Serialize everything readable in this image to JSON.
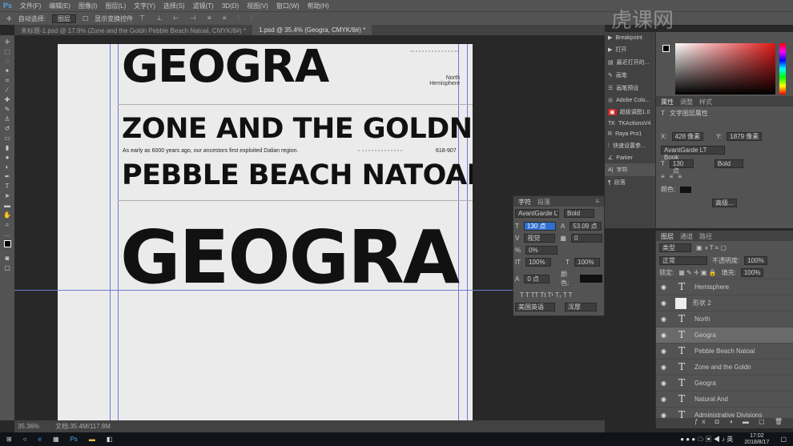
{
  "menu": {
    "items": [
      "文件(F)",
      "编辑(E)",
      "图像(I)",
      "图层(L)",
      "文字(Y)",
      "选择(S)",
      "滤镜(T)",
      "3D(D)",
      "视图(V)",
      "窗口(W)",
      "帮助(H)"
    ]
  },
  "options": {
    "auto_select_label": "自动选择:",
    "auto_select_value": "图层",
    "show_transform": "显示变换控件"
  },
  "tabs": [
    "未标题-1.psd @ 17.9% (Zone and the Goldn Pebble Beach Natoal, CMYK/8#) *",
    "1.psd @ 35.4% (Geogra, CMYK/8#) *"
  ],
  "canvas": {
    "title_small": "GEOGRA",
    "north": "North",
    "hemisphere": "Hemisphere",
    "zone": "ZONE AND THE GOLDN",
    "body": "As early as 6000 years ago, our ancestors first exploited Dalian region.",
    "phone": "618-907",
    "pebble": "PEBBLE BEACH NATOAL",
    "title_big": "GEOGRA"
  },
  "status": {
    "zoom": "35.36%",
    "doc": "文档:35.4M/117.8M"
  },
  "dock": {
    "items": [
      "Breakpoint",
      "打开",
      "最近打开的...",
      "画笔",
      "画笔预设",
      "Adobe Colo...",
      "超级调图1.0",
      "TKActionsV4",
      "Raya Pro1",
      "快速设置参...",
      "Parker"
    ],
    "char": "字符",
    "para": "段落"
  },
  "properties": {
    "tabs": [
      "属性",
      "调整",
      "样式"
    ],
    "type_label": "文字图层属性",
    "x": "428 像素",
    "y": "1879 像素",
    "font": "AvantGarde LT Book",
    "size": "130 点",
    "style": "Bold",
    "color_label": "颜色:",
    "more": "高级..."
  },
  "character": {
    "tabs": [
      "字符",
      "段落"
    ],
    "font": "AvantGarde LT...",
    "style": "Bold",
    "size": "130 点",
    "leading": "53.09 点",
    "kerning": "视觉",
    "tracking": "0",
    "scale_pct": "0%",
    "vscale": "100%",
    "hscale": "100%",
    "baseline": "0 点",
    "color_label": "颜色:",
    "language": "美国英语",
    "aa": "浑厚"
  },
  "layers": {
    "tabs": [
      "图层",
      "通道",
      "路径"
    ],
    "filter": "类型",
    "blend": "正常",
    "opacity_label": "不透明度:",
    "opacity": "100%",
    "lock_label": "锁定:",
    "fill_label": "填充:",
    "fill": "100%",
    "items": [
      {
        "name": "Hemisphere",
        "type": "text"
      },
      {
        "name": "形状 2",
        "type": "shape"
      },
      {
        "name": "North",
        "type": "text"
      },
      {
        "name": "Geogra",
        "type": "text",
        "selected": true
      },
      {
        "name": "Pebble Beach Natoal",
        "type": "text"
      },
      {
        "name": "Zone and the Goldn",
        "type": "text"
      },
      {
        "name": "Geogra",
        "type": "text"
      },
      {
        "name": "Natural And",
        "type": "text"
      },
      {
        "name": "Administrative Divisions",
        "type": "text"
      }
    ]
  },
  "taskbar": {
    "time": "17:02",
    "date": "2018/8/17"
  },
  "watermark": "虎课网"
}
